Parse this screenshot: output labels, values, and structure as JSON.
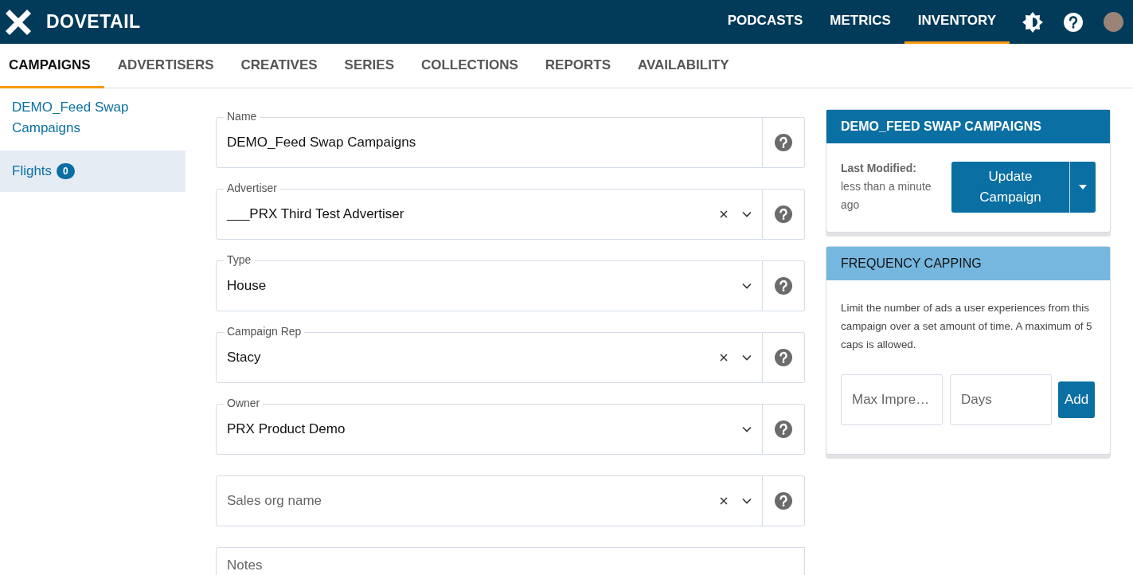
{
  "header": {
    "logo": "DOVETAIL",
    "nav": [
      {
        "label": "PODCASTS",
        "selected": false
      },
      {
        "label": "METRICS",
        "selected": false
      },
      {
        "label": "INVENTORY",
        "selected": true
      }
    ]
  },
  "tabs": [
    {
      "label": "CAMPAIGNS",
      "selected": true
    },
    {
      "label": "ADVERTISERS",
      "selected": false
    },
    {
      "label": "CREATIVES",
      "selected": false
    },
    {
      "label": "SERIES",
      "selected": false
    },
    {
      "label": "COLLECTIONS",
      "selected": false
    },
    {
      "label": "REPORTS",
      "selected": false
    },
    {
      "label": "AVAILABILITY",
      "selected": false
    }
  ],
  "sidebar": {
    "title": "DEMO_Feed Swap Campaigns",
    "items": [
      {
        "label": "Flights",
        "badge": "0",
        "selected": true
      }
    ]
  },
  "form": {
    "fields": [
      {
        "kind": "text",
        "label": "Name",
        "value": "DEMO_Feed Swap Campaigns",
        "clearable": false
      },
      {
        "kind": "select",
        "label": "Advertiser",
        "value": "___PRX Third Test Advertiser",
        "clearable": true
      },
      {
        "kind": "select",
        "label": "Type",
        "value": "House",
        "clearable": false
      },
      {
        "kind": "select",
        "label": "Campaign Rep",
        "value": "Stacy",
        "clearable": true
      },
      {
        "kind": "select",
        "label": "Owner",
        "value": "PRX Product Demo",
        "clearable": false
      },
      {
        "kind": "select",
        "placeholder": "Sales org name",
        "clearable": true
      },
      {
        "kind": "textarea",
        "placeholder": "Notes",
        "clearable": false
      }
    ]
  },
  "status_card": {
    "title": "DEMO_FEED SWAP CAMPAIGNS",
    "modified_label": "Last Modified:",
    "modified_value": "less than a minute ago",
    "button": "Update Campaign"
  },
  "frequency_card": {
    "title": "FREQUENCY CAPPING",
    "description": "Limit the number of ads a user experiences from this campaign over a set amount of time. A maximum of 5 caps is allowed.",
    "inputs": [
      {
        "placeholder": "Max Impre…"
      },
      {
        "placeholder": "Days"
      }
    ],
    "button": "Add"
  }
}
